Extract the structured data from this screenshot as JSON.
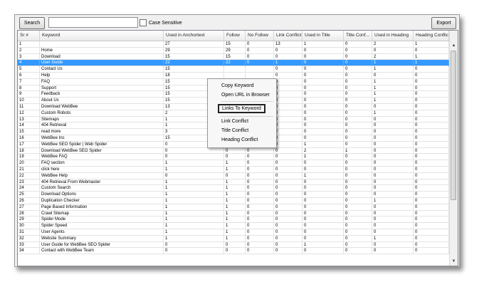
{
  "toolbar": {
    "search_label": "Search",
    "search_value": "",
    "case_sensitive_label": "Case Sensitive",
    "export_label": "Export"
  },
  "columns": [
    "Sr #",
    "Keyword",
    "Used in Anchortext",
    "Follow",
    "No Follow",
    "Link Conflict",
    "Used in Title",
    "Title Conf...",
    "Used in Heading",
    "Heading Conflict"
  ],
  "rows": [
    [
      "1",
      "",
      "27",
      "15",
      "0",
      "13",
      "1",
      "0",
      "2",
      "1"
    ],
    [
      "2",
      "Home",
      "29",
      "29",
      "0",
      "0",
      "0",
      "0",
      "0",
      "0"
    ],
    [
      "3",
      "Download",
      "15",
      "15",
      "0",
      "0",
      "0",
      "0",
      "2",
      "1"
    ],
    [
      "4",
      "User Guide",
      "22",
      "22",
      "0",
      "1",
      "0",
      "0",
      "1",
      "1"
    ],
    [
      "5",
      "Contact Us",
      "15",
      "",
      "",
      "0",
      "0",
      "0",
      "1",
      "0"
    ],
    [
      "6",
      "Help",
      "18",
      "",
      "",
      "0",
      "0",
      "0",
      "0",
      "0"
    ],
    [
      "7",
      "FAQ",
      "15",
      "",
      "",
      "0",
      "0",
      "0",
      "1",
      "0"
    ],
    [
      "8",
      "Support",
      "15",
      "",
      "",
      "0",
      "0",
      "0",
      "1",
      "0"
    ],
    [
      "9",
      "Feedback",
      "15",
      "",
      "",
      "0",
      "0",
      "0",
      "1",
      "0"
    ],
    [
      "10",
      "About Us",
      "15",
      "",
      "",
      "0",
      "0",
      "0",
      "1",
      "0"
    ],
    [
      "11",
      "Download WebBee",
      "13",
      "",
      "",
      "0",
      "0",
      "0",
      "0",
      "0"
    ],
    [
      "12",
      "Custom Robots",
      "2",
      "",
      "",
      "0",
      "0",
      "0",
      "1",
      "0"
    ],
    [
      "13",
      "Sitemaps",
      "1",
      "",
      "",
      "0",
      "0",
      "0",
      "0",
      "0"
    ],
    [
      "14",
      "404 Retrieval",
      "1",
      "1",
      "0",
      "0",
      "0",
      "0",
      "0",
      "0"
    ],
    [
      "15",
      "read more",
      "3",
      "3",
      "0",
      "2",
      "0",
      "0",
      "0",
      "0"
    ],
    [
      "16",
      "WebBee Inc",
      "15",
      "15",
      "0",
      "0",
      "0",
      "0",
      "0",
      "0"
    ],
    [
      "17",
      "WebBee SEO Spider | Web Spider",
      "0",
      "0",
      "0",
      "0",
      "1",
      "0",
      "0",
      "0"
    ],
    [
      "18",
      "Download WebBee SEO Spider",
      "0",
      "0",
      "0",
      "0",
      "2",
      "1",
      "0",
      "0"
    ],
    [
      "19",
      "WebBee FAQ",
      "0",
      "0",
      "0",
      "0",
      "1",
      "0",
      "0",
      "0"
    ],
    [
      "20",
      "FAQ section",
      "1",
      "1",
      "0",
      "0",
      "0",
      "0",
      "0",
      "0"
    ],
    [
      "21",
      "click here",
      "1",
      "1",
      "0",
      "0",
      "0",
      "0",
      "0",
      "0"
    ],
    [
      "22",
      "WebBee Help",
      "0",
      "0",
      "0",
      "0",
      "1",
      "0",
      "0",
      "0"
    ],
    [
      "23",
      "404 Retrieval From Webmaster",
      "1",
      "1",
      "0",
      "0",
      "0",
      "0",
      "0",
      "0"
    ],
    [
      "24",
      "Custom Search",
      "1",
      "1",
      "0",
      "0",
      "0",
      "0",
      "0",
      "0"
    ],
    [
      "25",
      "Download Options",
      "1",
      "1",
      "0",
      "0",
      "0",
      "0",
      "0",
      "0"
    ],
    [
      "26",
      "Duplication Checker",
      "1",
      "1",
      "0",
      "0",
      "0",
      "0",
      "1",
      "0"
    ],
    [
      "27",
      "Page Based Information",
      "1",
      "1",
      "0",
      "0",
      "0",
      "0",
      "0",
      "0"
    ],
    [
      "28",
      "Crawl Sitemap",
      "1",
      "1",
      "0",
      "0",
      "0",
      "0",
      "0",
      "0"
    ],
    [
      "29",
      "Spider Mode",
      "1",
      "1",
      "0",
      "0",
      "0",
      "0",
      "0",
      "0"
    ],
    [
      "30",
      "Spider Speed",
      "1",
      "1",
      "0",
      "0",
      "0",
      "0",
      "0",
      "0"
    ],
    [
      "31",
      "User Agents",
      "1",
      "1",
      "0",
      "0",
      "0",
      "0",
      "0",
      "0"
    ],
    [
      "32",
      "Website Summary",
      "1",
      "1",
      "0",
      "0",
      "0",
      "0",
      "1",
      "0"
    ],
    [
      "33",
      "User Guide for WebBee SEO Spider",
      "0",
      "0",
      "0",
      "0",
      "1",
      "0",
      "0",
      "0"
    ],
    [
      "34",
      "Contact with WebBee Team",
      "0",
      "0",
      "0",
      "0",
      "0",
      "0",
      "0",
      "0"
    ]
  ],
  "selected_row": "4",
  "context_menu": {
    "copy_keyword": "Copy Keyword",
    "open_url": "Open URL in Browser",
    "links_to_keyword": "Links To Keyword",
    "link_conflict": "Link Conflict",
    "title_conflict": "Title Conflict",
    "heading_conflict": "Heading Conflict"
  },
  "colors": {
    "selection": "#3399ff",
    "menu_background": "#f7f7f7"
  },
  "icons": {
    "scroll_up": "scroll-up-arrow-icon",
    "scroll_down": "scroll-down-arrow-icon"
  }
}
